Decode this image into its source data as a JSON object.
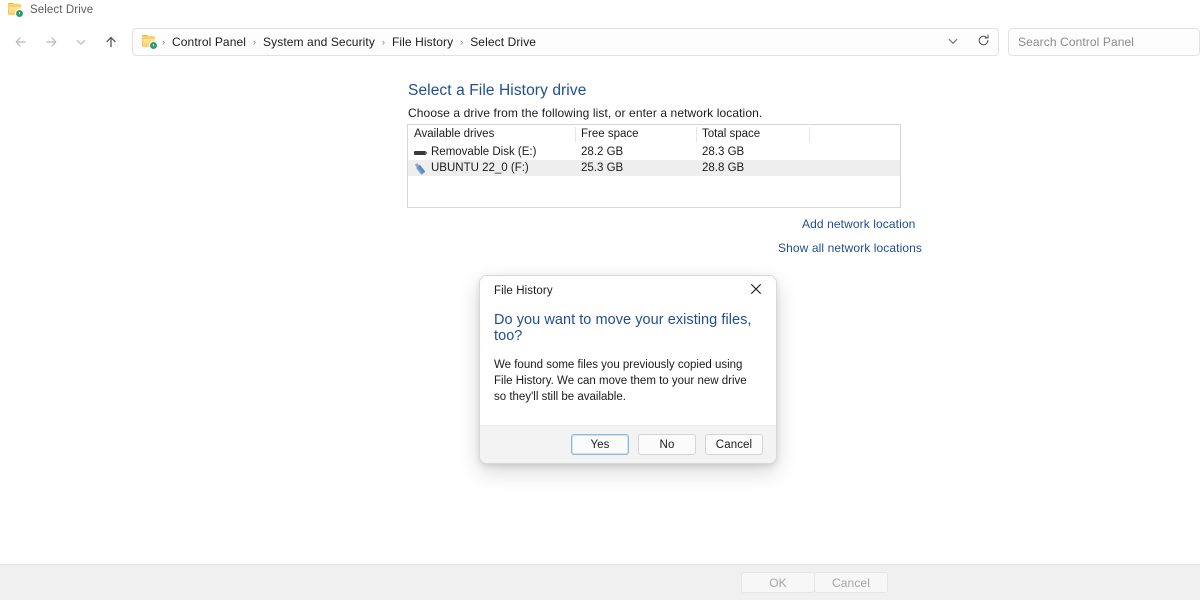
{
  "window": {
    "title": "Select Drive",
    "icon": "file-history-folder-icon"
  },
  "navbar": {
    "back_icon": "arrow-left-icon",
    "forward_icon": "arrow-right-icon",
    "recent_icon": "chevron-down-icon",
    "up_icon": "arrow-up-icon",
    "address_icon": "file-history-folder-icon",
    "breadcrumbs": [
      "Control Panel",
      "System and Security",
      "File History",
      "Select Drive"
    ],
    "separator": "›",
    "history_icon": "chevron-down-icon",
    "refresh_icon": "refresh-icon",
    "search": {
      "placeholder": "Search Control Panel",
      "value": "",
      "icon": "search-icon"
    }
  },
  "main": {
    "title": "Select a File History drive",
    "subtitle": "Choose a drive from the following list, or enter a network location.",
    "table": {
      "columns": [
        "Available drives",
        "Free space",
        "Total space",
        ""
      ],
      "rows": [
        {
          "icon": "usb-drive-icon",
          "name": "Removable Disk (E:)",
          "free_space": "28.2 GB",
          "total_space": "28.3 GB",
          "selected": false
        },
        {
          "icon": "usb-flash-drive-icon",
          "name": "UBUNTU 22_0 (F:)",
          "free_space": "25.3 GB",
          "total_space": "28.8 GB",
          "selected": true
        }
      ]
    },
    "links": {
      "add_network_location": "Add network location",
      "show_all_network_locations": "Show all network locations"
    }
  },
  "footer": {
    "ok_label": "OK",
    "cancel_label": "Cancel"
  },
  "dialog": {
    "title": "File History",
    "close_icon": "close-icon",
    "heading": "Do you want to move your existing files, too?",
    "body": "We found some files you previously copied using File History. We can move them to your new drive so they'll still be available.",
    "buttons": {
      "yes": "Yes",
      "no": "No",
      "cancel": "Cancel"
    }
  },
  "colors": {
    "accent_link": "#1f4e93",
    "selection": "#eeeeee",
    "footer_bg": "#f0f0f0",
    "focus_ring": "#8fb8e0"
  }
}
